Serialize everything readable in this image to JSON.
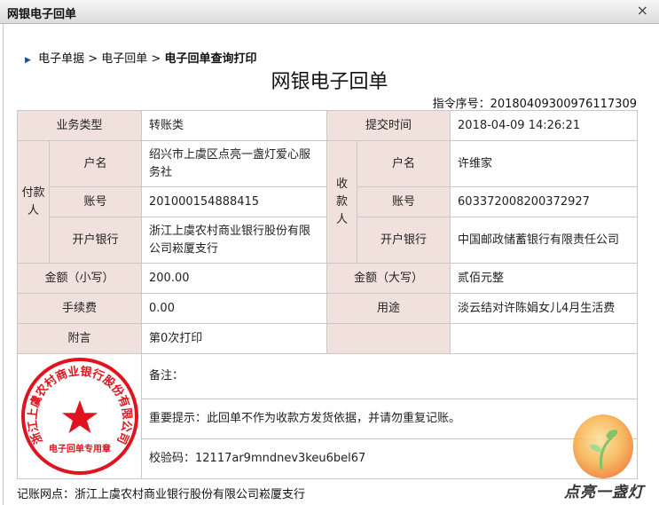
{
  "window": {
    "title": "网银电子回单",
    "close_glyph": "×"
  },
  "breadcrumb": {
    "item1": "电子单据",
    "sep": ">",
    "item2": "电子回单",
    "current": "电子回单查询打印"
  },
  "doc_title": "网银电子回单",
  "sequence": "指令序号：20180409300976117309",
  "table": {
    "biz_type_label": "业务类型",
    "biz_type_value": "转账类",
    "submit_time_label": "提交时间",
    "submit_time_value": "2018-04-09 14:26:21",
    "payer_label": "付款人",
    "payee_label": "收款人",
    "name_label": "户名",
    "account_label": "账号",
    "bank_label": "开户银行",
    "payer_name": "绍兴市上虞区点亮一盏灯爱心服务社",
    "payer_account": "201000154888415",
    "payer_bank": "浙江上虞农村商业银行股份有限公司崧厦支行",
    "payee_name": "许维家",
    "payee_account": "603372008200372927",
    "payee_bank": "中国邮政储蓄银行有限责任公司",
    "amount_lower_label": "金额（小写）",
    "amount_lower_value": "200.00",
    "amount_upper_label": "金额（大写）",
    "amount_upper_value": "贰佰元整",
    "fee_label": "手续费",
    "fee_value": "0.00",
    "purpose_label": "用途",
    "purpose_value": "淡云结对许陈娟女儿4月生活费",
    "note_label": "附言",
    "note_value": "第0次打印",
    "remark": "备注：",
    "important": "重要提示：此回单不作为收款方发货依据，并请勿重复记账。",
    "checksum": "校验码：12117ar9mndnev3keu6bel67"
  },
  "seal": {
    "text": "浙江上虞农村商业银行股份有限公司",
    "bottom_text": "电子回单专用章",
    "color": "#e0141e"
  },
  "footer_partial": "记账网点：浙江上虞农村商业银行股份有限公司崧厦支行",
  "watermark": {
    "text": "点亮一盏灯",
    "colors": [
      "#f6b14b",
      "#f07a2a"
    ]
  }
}
